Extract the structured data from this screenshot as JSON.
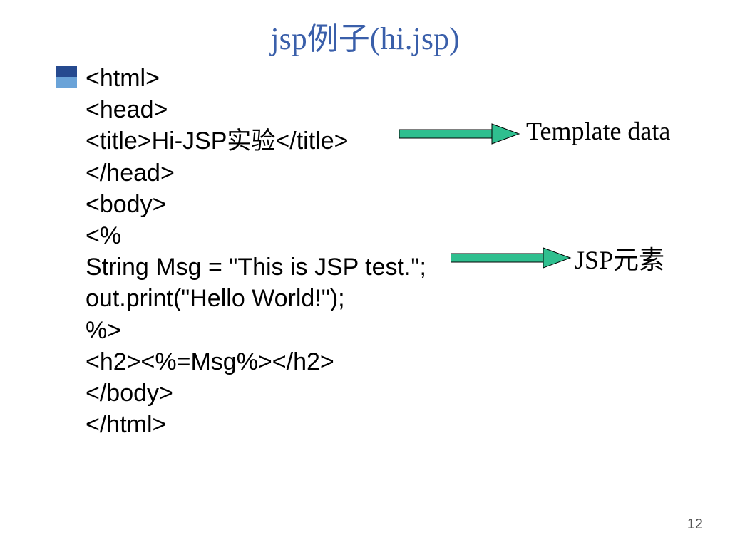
{
  "title": "jsp例子(hi.jsp)",
  "code": {
    "l1": "<html>",
    "l2": "<head>",
    "l3": "<title>Hi-JSP实验</title>",
    "l4": "</head>",
    "l5": "<body>",
    "l6": "<%",
    "l7": "String Msg = \"This is JSP test.\";",
    "l8": "out.print(\"Hello World!\");",
    "l9": "%>",
    "l10": "<h2><%=Msg%></h2>",
    "l11": "</body>",
    "l12": "</html>"
  },
  "annot": {
    "template": "Template data",
    "jsp": "JSP元素"
  },
  "pagenum": "12"
}
